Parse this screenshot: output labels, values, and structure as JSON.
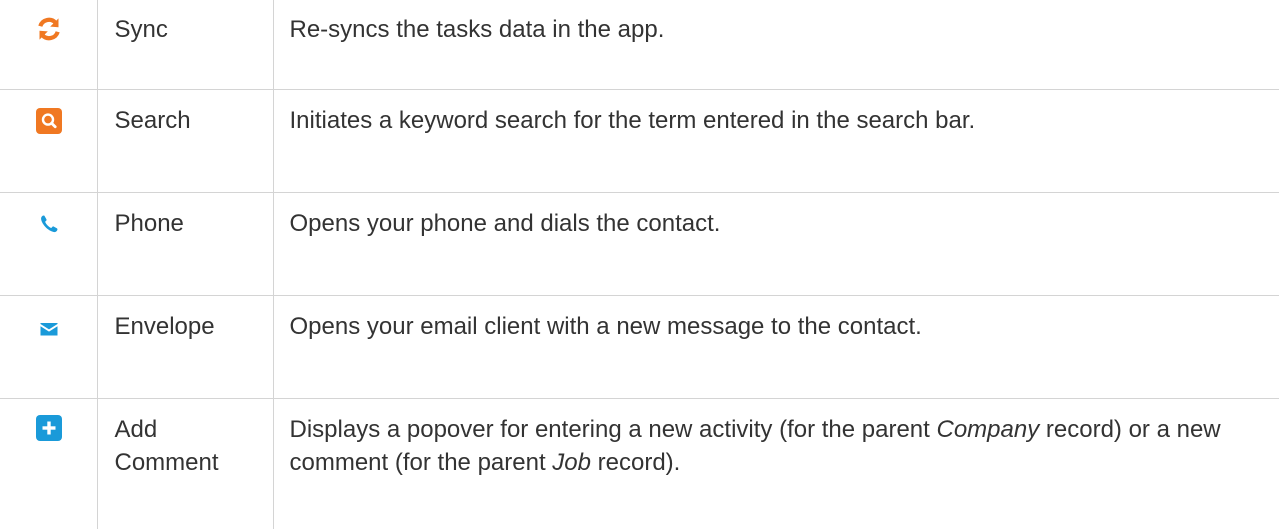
{
  "colors": {
    "orange": "#F07822",
    "blue": "#1A9AD9",
    "text": "#333333",
    "border": "#D4D4D4"
  },
  "rows": [
    {
      "icon": "sync-icon",
      "name": "Sync",
      "description": "Re-syncs the tasks data in the app."
    },
    {
      "icon": "search-icon",
      "name": "Search",
      "description": "Initiates a keyword search for the term entered in the search bar."
    },
    {
      "icon": "phone-icon",
      "name": "Phone",
      "description": "Opens your phone and dials the contact."
    },
    {
      "icon": "envelope-icon",
      "name": "Envelope",
      "description": "Opens your email client with a new message to the contact."
    },
    {
      "icon": "add-comment-icon",
      "name": "Add Comment",
      "description_parts": {
        "p1": "Displays a popover for entering a new activity (for the parent ",
        "em1": "Company",
        "p2": " record) or a new comment (for the parent ",
        "em2": "Job",
        "p3": " record)."
      }
    }
  ]
}
